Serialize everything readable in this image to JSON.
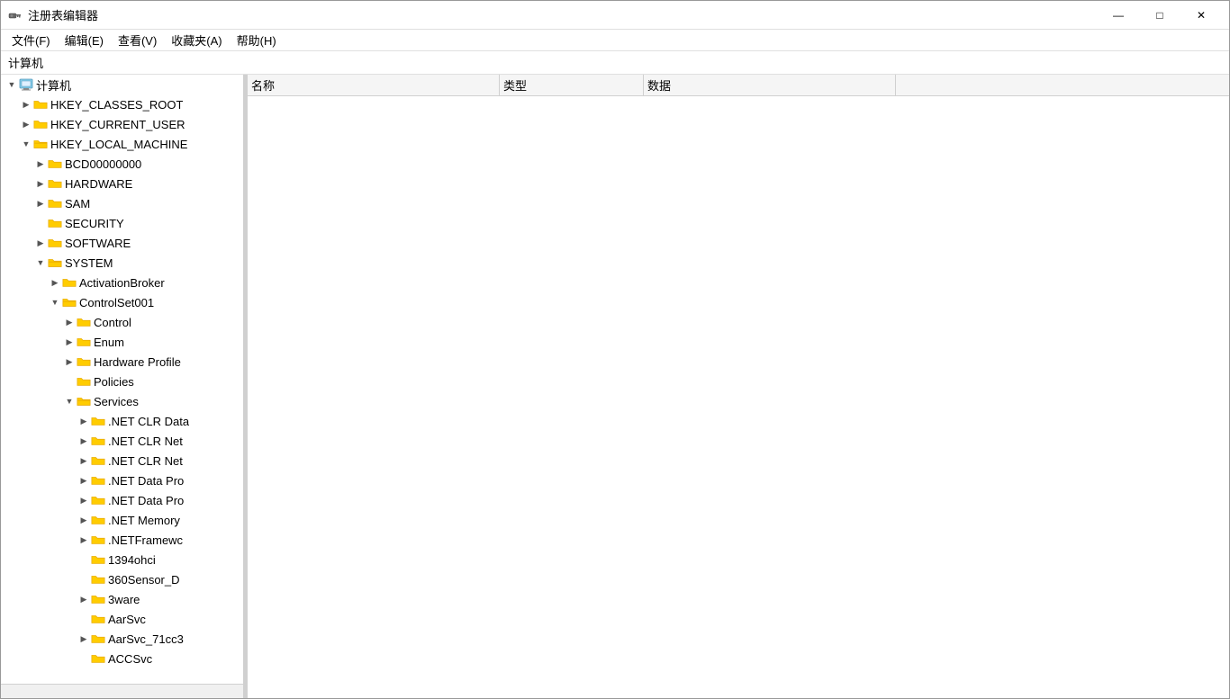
{
  "window": {
    "title": "注册表编辑器",
    "icon": "regedit-icon"
  },
  "titlebar": {
    "minimize_label": "—",
    "maximize_label": "□",
    "close_label": "✕"
  },
  "menubar": {
    "items": [
      {
        "id": "file",
        "label": "文件(F)"
      },
      {
        "id": "edit",
        "label": "编辑(E)"
      },
      {
        "id": "view",
        "label": "查看(V)"
      },
      {
        "id": "favorites",
        "label": "收藏夹(A)"
      },
      {
        "id": "help",
        "label": "帮助(H)"
      }
    ]
  },
  "addressbar": {
    "path": "计算机"
  },
  "tree": {
    "header": "",
    "nodes": [
      {
        "id": "computer",
        "label": "计算机",
        "indent": 0,
        "toggle": "▼",
        "type": "computer",
        "selected": false,
        "expanded": true
      },
      {
        "id": "hkcr",
        "label": "HKEY_CLASSES_ROOT",
        "indent": 1,
        "toggle": "▶",
        "type": "folder",
        "selected": false
      },
      {
        "id": "hkcu",
        "label": "HKEY_CURRENT_USER",
        "indent": 1,
        "toggle": "▶",
        "type": "folder",
        "selected": false
      },
      {
        "id": "hklm",
        "label": "HKEY_LOCAL_MACHINE",
        "indent": 1,
        "toggle": "▼",
        "type": "folder",
        "selected": false,
        "expanded": true
      },
      {
        "id": "bcd",
        "label": "BCD00000000",
        "indent": 2,
        "toggle": "▶",
        "type": "folder",
        "selected": false
      },
      {
        "id": "hardware",
        "label": "HARDWARE",
        "indent": 2,
        "toggle": "▶",
        "type": "folder",
        "selected": false
      },
      {
        "id": "sam",
        "label": "SAM",
        "indent": 2,
        "toggle": "▶",
        "type": "folder",
        "selected": false
      },
      {
        "id": "security",
        "label": "SECURITY",
        "indent": 2,
        "toggle": "",
        "type": "folder",
        "selected": false
      },
      {
        "id": "software",
        "label": "SOFTWARE",
        "indent": 2,
        "toggle": "▶",
        "type": "folder",
        "selected": false
      },
      {
        "id": "system",
        "label": "SYSTEM",
        "indent": 2,
        "toggle": "▼",
        "type": "folder",
        "selected": false,
        "expanded": true
      },
      {
        "id": "activation",
        "label": "ActivationBroker",
        "indent": 3,
        "toggle": "▶",
        "type": "folder",
        "selected": false
      },
      {
        "id": "controlset001",
        "label": "ControlSet001",
        "indent": 3,
        "toggle": "▼",
        "type": "folder",
        "selected": false,
        "expanded": true
      },
      {
        "id": "control",
        "label": "Control",
        "indent": 4,
        "toggle": "▶",
        "type": "folder",
        "selected": false
      },
      {
        "id": "enum",
        "label": "Enum",
        "indent": 4,
        "toggle": "▶",
        "type": "folder",
        "selected": false
      },
      {
        "id": "hwprofile",
        "label": "Hardware Profile",
        "indent": 4,
        "toggle": "▶",
        "type": "folder",
        "selected": false
      },
      {
        "id": "policies",
        "label": "Policies",
        "indent": 4,
        "toggle": "",
        "type": "folder",
        "selected": false
      },
      {
        "id": "services",
        "label": "Services",
        "indent": 4,
        "toggle": "▼",
        "type": "folder",
        "selected": false,
        "expanded": true
      },
      {
        "id": "netclrdata",
        "label": ".NET CLR Data",
        "indent": 5,
        "toggle": "▶",
        "type": "folder",
        "selected": false
      },
      {
        "id": "netclrnet1",
        "label": ".NET CLR Net",
        "indent": 5,
        "toggle": "▶",
        "type": "folder",
        "selected": false
      },
      {
        "id": "netclrnet2",
        "label": ".NET CLR Net",
        "indent": 5,
        "toggle": "▶",
        "type": "folder",
        "selected": false
      },
      {
        "id": "netdatapro1",
        "label": ".NET Data Pro",
        "indent": 5,
        "toggle": "▶",
        "type": "folder",
        "selected": false
      },
      {
        "id": "netdatapro2",
        "label": ".NET Data Pro",
        "indent": 5,
        "toggle": "▶",
        "type": "folder",
        "selected": false
      },
      {
        "id": "netmemory",
        "label": ".NET Memory",
        "indent": 5,
        "toggle": "▶",
        "type": "folder",
        "selected": false
      },
      {
        "id": "netframework",
        "label": ".NETFramewc",
        "indent": 5,
        "toggle": "▶",
        "type": "folder",
        "selected": false
      },
      {
        "id": "ohci1394",
        "label": "1394ohci",
        "indent": 5,
        "toggle": "",
        "type": "folder",
        "selected": false
      },
      {
        "id": "sensor360",
        "label": "360Sensor_D",
        "indent": 5,
        "toggle": "",
        "type": "folder",
        "selected": false
      },
      {
        "id": "3ware",
        "label": "3ware",
        "indent": 5,
        "toggle": "▶",
        "type": "folder",
        "selected": false
      },
      {
        "id": "aarsvc",
        "label": "AarSvc",
        "indent": 5,
        "toggle": "",
        "type": "folder",
        "selected": false
      },
      {
        "id": "aarsvc71cc",
        "label": "AarSvc_71cc3",
        "indent": 5,
        "toggle": "▶",
        "type": "folder",
        "selected": false
      },
      {
        "id": "accsvc",
        "label": "ACCSvc",
        "indent": 5,
        "toggle": "",
        "type": "folder",
        "selected": false
      }
    ]
  },
  "rightpanel": {
    "columns": [
      {
        "id": "name",
        "label": "名称"
      },
      {
        "id": "type",
        "label": "类型"
      },
      {
        "id": "data",
        "label": "数据"
      }
    ],
    "rows": []
  },
  "colors": {
    "folder_yellow": "#FFCC66",
    "folder_dark": "#E6B800",
    "selected_bg": "#0078D7",
    "header_bg": "#F5F5F5",
    "border": "#D0D0D0"
  }
}
